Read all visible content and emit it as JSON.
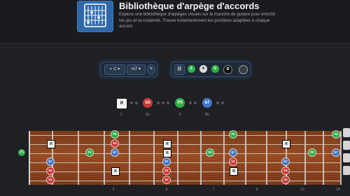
{
  "header": {
    "title": "Bibliothèque d'arpège d'accords",
    "description": "Explore une bibliothèque d'arpèges visuels sur le manche de guitare pour enrichir ton jeu et ta créativité. Trouve instantanément les positions adaptées à chaque accord."
  },
  "toolbar": {
    "key_value": "C",
    "chord_value": "m7",
    "chip_labels": [
      "E",
      "G",
      "B"
    ]
  },
  "chord": {
    "notes": [
      {
        "label": "R",
        "name": "C",
        "kind": "root"
      },
      {
        "label": "b3",
        "name": "Eb",
        "kind": "red"
      },
      {
        "label": "P5",
        "name": "G",
        "kind": "green"
      },
      {
        "label": "b7",
        "name": "Bb",
        "kind": "blue"
      }
    ]
  },
  "fretboard": {
    "fret_numbers": [
      "3",
      "5",
      "7",
      "9",
      "12",
      "15"
    ],
    "notes": [
      {
        "label": "P5",
        "type": "green"
      },
      {
        "label": "P5",
        "type": "green"
      },
      {
        "label": "P5",
        "type": "green"
      },
      {
        "label": "P5",
        "type": "green"
      },
      {
        "label": "P5",
        "type": "green"
      },
      {
        "label": "P5",
        "type": "green"
      },
      {
        "label": "P5",
        "type": "green"
      },
      {
        "label": "R",
        "type": "root"
      },
      {
        "label": "R",
        "type": "root"
      },
      {
        "label": "R",
        "type": "root"
      },
      {
        "label": "R",
        "type": "root"
      },
      {
        "label": "R",
        "type": "root"
      },
      {
        "label": "R",
        "type": "root"
      },
      {
        "label": "b7",
        "type": "blue"
      },
      {
        "label": "b7",
        "type": "blue"
      },
      {
        "label": "b7",
        "type": "blue"
      },
      {
        "label": "b7",
        "type": "blue"
      },
      {
        "label": "b7",
        "type": "blue"
      },
      {
        "label": "b7",
        "type": "blue"
      },
      {
        "label": "b3",
        "type": "red"
      },
      {
        "label": "b3",
        "type": "red"
      },
      {
        "label": "b3",
        "type": "red"
      },
      {
        "label": "b3",
        "type": "red"
      },
      {
        "label": "b3",
        "type": "red"
      },
      {
        "label": "b3",
        "type": "red"
      },
      {
        "label": "b3",
        "type": "red"
      },
      {
        "label": "b3",
        "type": "red"
      }
    ]
  },
  "colors": {
    "accent": "#2f68a8",
    "root": "#f2f2f2",
    "third": "#c73a3a",
    "fifth": "#2eaf48",
    "seventh": "#3f77c9"
  }
}
